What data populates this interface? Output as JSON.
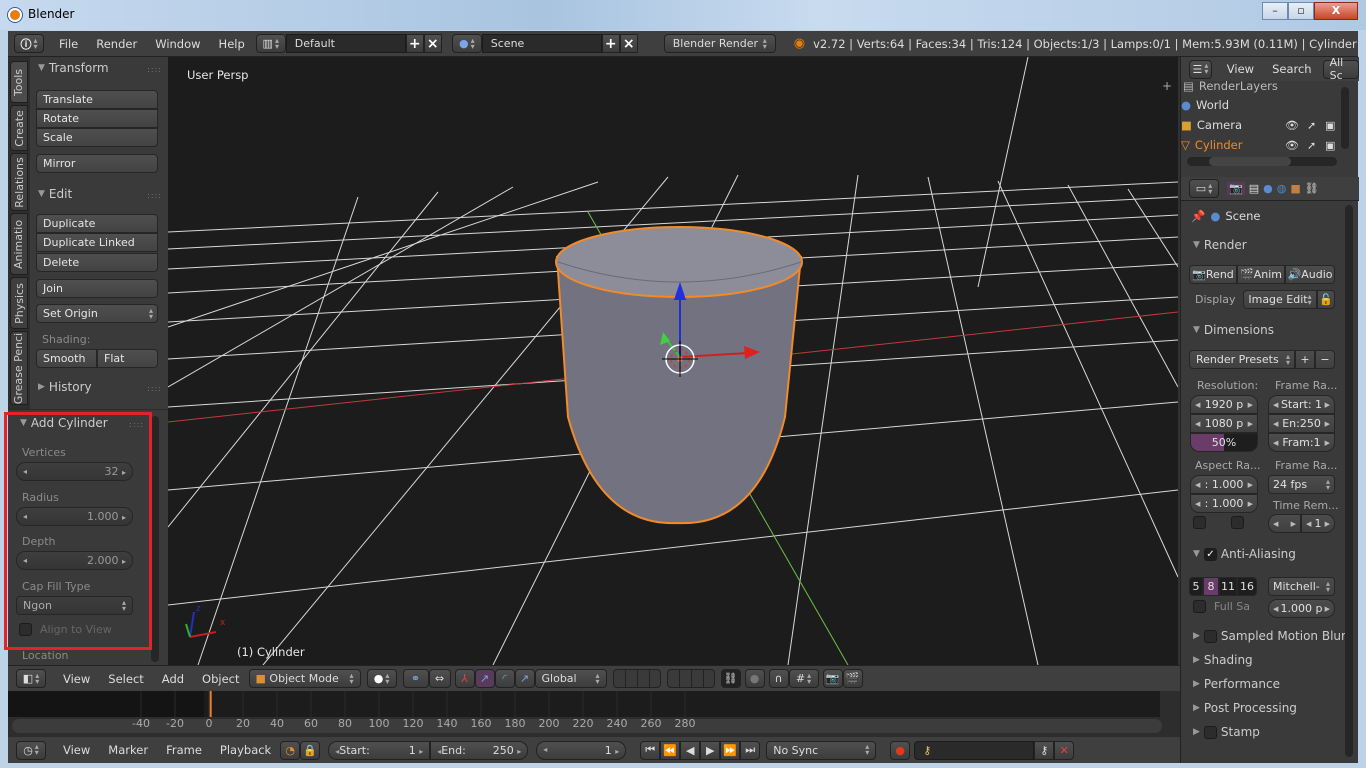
{
  "window": {
    "title": "Blender",
    "minimize": "–",
    "maximize": "▫",
    "close": "X"
  },
  "info_header": {
    "menus": [
      "File",
      "Render",
      "Window",
      "Help"
    ],
    "layout": "Default",
    "scene": "Scene",
    "engine": "Blender Render",
    "stats": "v2.72 | Verts:64 | Faces:34 | Tris:124 | Objects:1/3 | Lamps:0/1 | Mem:5.93M (0.11M) | Cylinder"
  },
  "toolshelf": {
    "tabs": [
      "Tools",
      "Create",
      "Relations",
      "Animatio",
      "Physics",
      "Grease Penci"
    ],
    "transform": {
      "title": "Transform",
      "buttons": [
        "Translate",
        "Rotate",
        "Scale"
      ],
      "mirror": "Mirror"
    },
    "edit": {
      "title": "Edit",
      "buttons": [
        "Duplicate",
        "Duplicate Linked",
        "Delete"
      ],
      "join": "Join",
      "set_origin": "Set Origin",
      "shading_label": "Shading:",
      "smooth": "Smooth",
      "flat": "Flat"
    },
    "history": {
      "title": "History"
    },
    "operator": {
      "title": "Add Cylinder",
      "vertices_label": "Vertices",
      "vertices": "32",
      "radius_label": "Radius",
      "radius": "1.000",
      "depth_label": "Depth",
      "depth": "2.000",
      "cap_fill_label": "Cap Fill Type",
      "cap_fill": "Ngon",
      "align_label": "Align to View",
      "location_label": "Location"
    }
  },
  "viewport": {
    "view_name": "User Persp",
    "object_label": "(1) Cylinder",
    "axis_x": "x",
    "axis_y": "y",
    "axis_z": "z"
  },
  "outliner": {
    "menus": [
      "View",
      "Search"
    ],
    "filter": "All Sc",
    "items": [
      {
        "name": "RenderLayers",
        "active": false
      },
      {
        "name": "World",
        "active": false
      },
      {
        "name": "Camera",
        "active": false
      },
      {
        "name": "Cylinder",
        "active": true
      }
    ]
  },
  "properties": {
    "context": "Scene",
    "render": {
      "title": "Render",
      "buttons": [
        "Rend",
        "Anim",
        "Audio"
      ],
      "display_label": "Display",
      "display": "Image Edit"
    },
    "dimensions": {
      "title": "Dimensions",
      "presets": "Render Presets",
      "resolution_label": "Resolution:",
      "res_x": "1920 p",
      "res_y": "1080 p",
      "res_pct": "50%",
      "res_pct_value": 0.5,
      "frame_range_label": "Frame Ra...",
      "start": "Start: 1",
      "end": "En:250",
      "frame": "Fram:1",
      "aspect_label": "Aspect Ra...",
      "aspect_x": ": 1.000",
      "aspect_y": ": 1.000",
      "fps_label": "Frame Ra...",
      "fps": "24 fps",
      "time_remap_label": "Time Rem...",
      "time_remap": "1"
    },
    "aa": {
      "title": "Anti-Aliasing",
      "samples": [
        "5",
        "8",
        "11",
        "16"
      ],
      "selected": "8",
      "filter": "Mitchell-",
      "full_sample": "Full Sa",
      "size": "1.000 p"
    },
    "collapsed": [
      "Sampled Motion Blur",
      "Shading",
      "Performance",
      "Post Processing",
      "Stamp"
    ]
  },
  "view3d_header": {
    "menus": [
      "View",
      "Select",
      "Add",
      "Object"
    ],
    "mode": "Object Mode",
    "orientation": "Global"
  },
  "timeline": {
    "ticks": [
      "-40",
      "-20",
      "0",
      "20",
      "40",
      "60",
      "80",
      "100",
      "120",
      "140",
      "160",
      "180",
      "200",
      "220",
      "240",
      "260",
      "280"
    ],
    "current_frame": 1,
    "menus": [
      "View",
      "Marker",
      "Frame",
      "Playback"
    ],
    "start_label": "Start:",
    "start": "1",
    "end_label": "End:",
    "end": "250",
    "frame": "1",
    "sync": "No Sync"
  }
}
